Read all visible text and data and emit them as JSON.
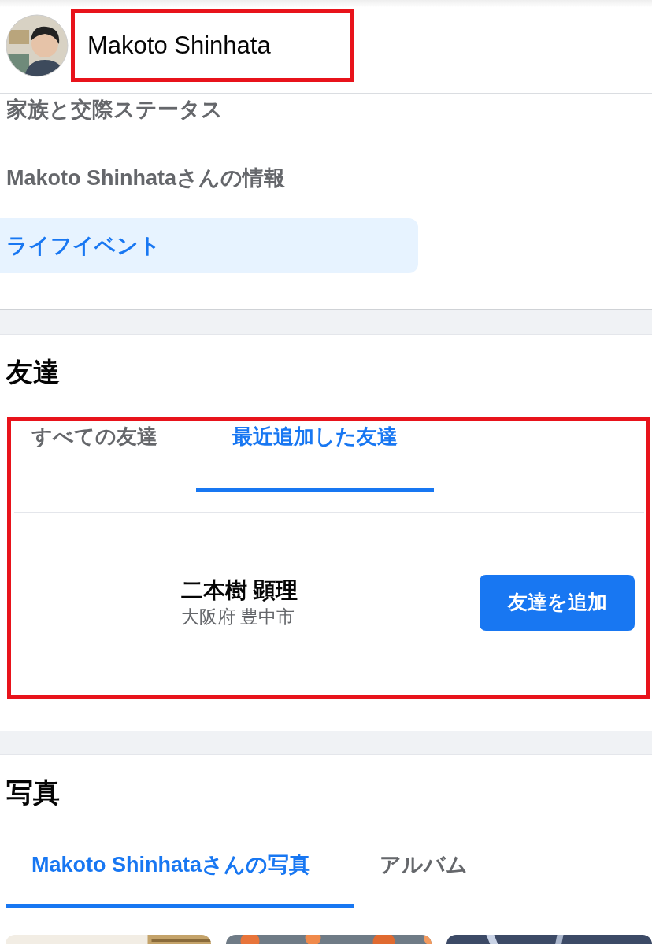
{
  "header": {
    "name": "Makoto Shinhata",
    "highlighted": true
  },
  "about_menu": [
    {
      "label": "家族と交際ステータス",
      "selected": false
    },
    {
      "label": "Makoto Shinhataさんの情報",
      "selected": false
    },
    {
      "label": "ライフイベント",
      "selected": true
    }
  ],
  "friends": {
    "title": "友達",
    "highlighted": true,
    "tabs": [
      {
        "label": "すべての友達",
        "selected": false
      },
      {
        "label": "最近追加した友達",
        "selected": true
      }
    ],
    "list": [
      {
        "name": "二本樹 顕理",
        "location": "大阪府 豊中市",
        "button": "友達を追加"
      }
    ]
  },
  "photos": {
    "title": "写真",
    "tabs": [
      {
        "label": "Makoto Shinhataさんの写真",
        "selected": true
      },
      {
        "label": "アルバム",
        "selected": false
      }
    ]
  }
}
